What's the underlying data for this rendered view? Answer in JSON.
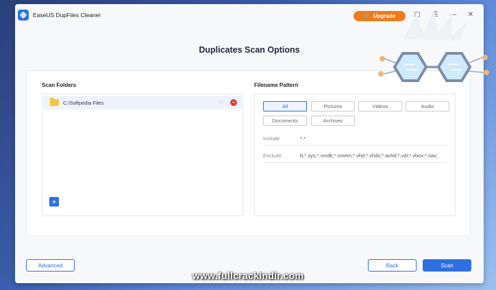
{
  "window": {
    "app_title": "EaseUS DupFiles Cleaner",
    "upgrade_label": "Upgrade",
    "icons": [
      "cart-icon",
      "chat-icon",
      "menu-icon",
      "minimize-icon",
      "close-icon"
    ]
  },
  "page_title": "Duplicates Scan Options",
  "scan_folders": {
    "label": "Scan Folders",
    "items": [
      {
        "path": "C:/Softpedia Files"
      }
    ],
    "add_icon": "plus-icon"
  },
  "filename_pattern": {
    "label": "Filename Pattern",
    "chips": [
      "All",
      "Pictures",
      "Videos",
      "Audio",
      "Documents",
      "Archives"
    ],
    "selected": "All",
    "include_label": "Include",
    "include_value": "*.*",
    "exclude_label": "Exclude",
    "exclude_value": "b;*.sys;*.vmdk;*.vmem;*.vhd;*.vhdx;*.avhd;*.vdi;*.vbox;*.sav;"
  },
  "buttons": {
    "advanced": "Advanced",
    "back": "Back",
    "scan": "Scan"
  },
  "watermark": "www.fullcrackindir.com",
  "colors": {
    "accent": "#2f6fde",
    "upgrade": "#f07a1a",
    "remove": "#e23b3b",
    "folder": "#f5c542"
  }
}
